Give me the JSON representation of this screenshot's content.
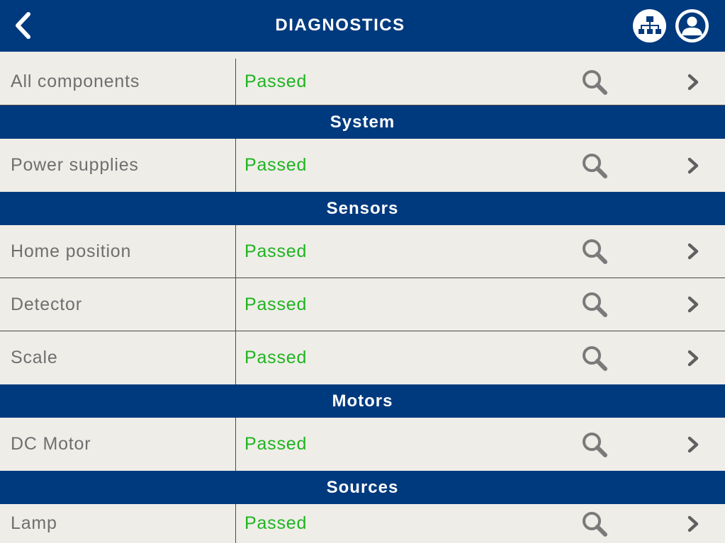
{
  "header": {
    "title": "DIAGNOSTICS",
    "back_icon": "chevron-left-icon",
    "network_icon": "network-icon",
    "user_icon": "user-icon"
  },
  "colors": {
    "header_bg": "#003a7e",
    "row_bg": "#eeede8",
    "status_passed": "#1fb41f",
    "label_text": "#6f6f6f"
  },
  "all_components": {
    "name": "All components",
    "status": "Passed"
  },
  "sections": [
    {
      "title": "System",
      "items": [
        {
          "name": "Power supplies",
          "status": "Passed"
        }
      ]
    },
    {
      "title": "Sensors",
      "items": [
        {
          "name": "Home position",
          "status": "Passed"
        },
        {
          "name": "Detector",
          "status": "Passed"
        },
        {
          "name": "Scale",
          "status": "Passed"
        }
      ]
    },
    {
      "title": "Motors",
      "items": [
        {
          "name": "DC Motor",
          "status": "Passed"
        }
      ]
    },
    {
      "title": "Sources",
      "items": [
        {
          "name": "Lamp",
          "status": "Passed"
        }
      ]
    }
  ]
}
